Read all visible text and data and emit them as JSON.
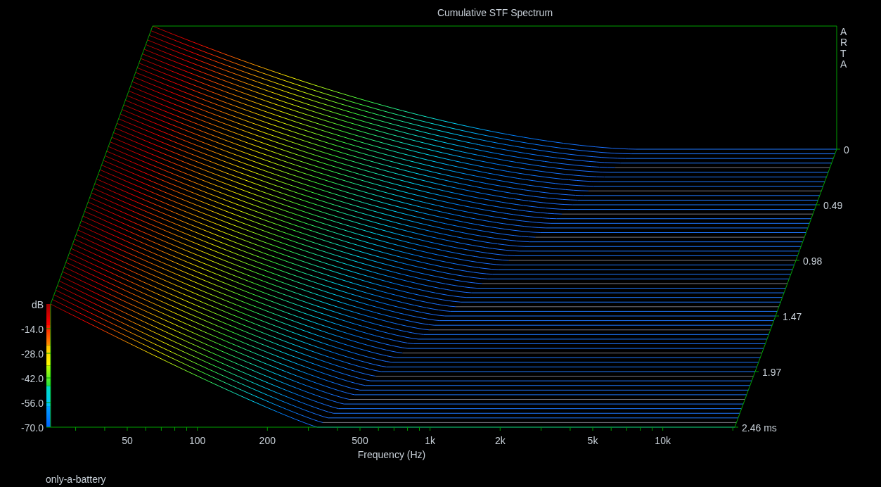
{
  "title": "Cumulative STF Spectrum",
  "logo_text": "ARTA",
  "level_axis": {
    "unit": "dB",
    "ticks": [
      "-14.0",
      "-28.0",
      "-42.0",
      "-56.0",
      "-70.0"
    ]
  },
  "frequency_axis": {
    "label": "Frequency (Hz)",
    "ticks": [
      "50",
      "100",
      "200",
      "500",
      "1k",
      "2k",
      "5k",
      "10k"
    ]
  },
  "time_axis": {
    "ticks": [
      "0",
      "0.49",
      "0.98",
      "1.47",
      "1.97",
      "2.46 ms"
    ]
  },
  "footer": "only-a-battery"
}
